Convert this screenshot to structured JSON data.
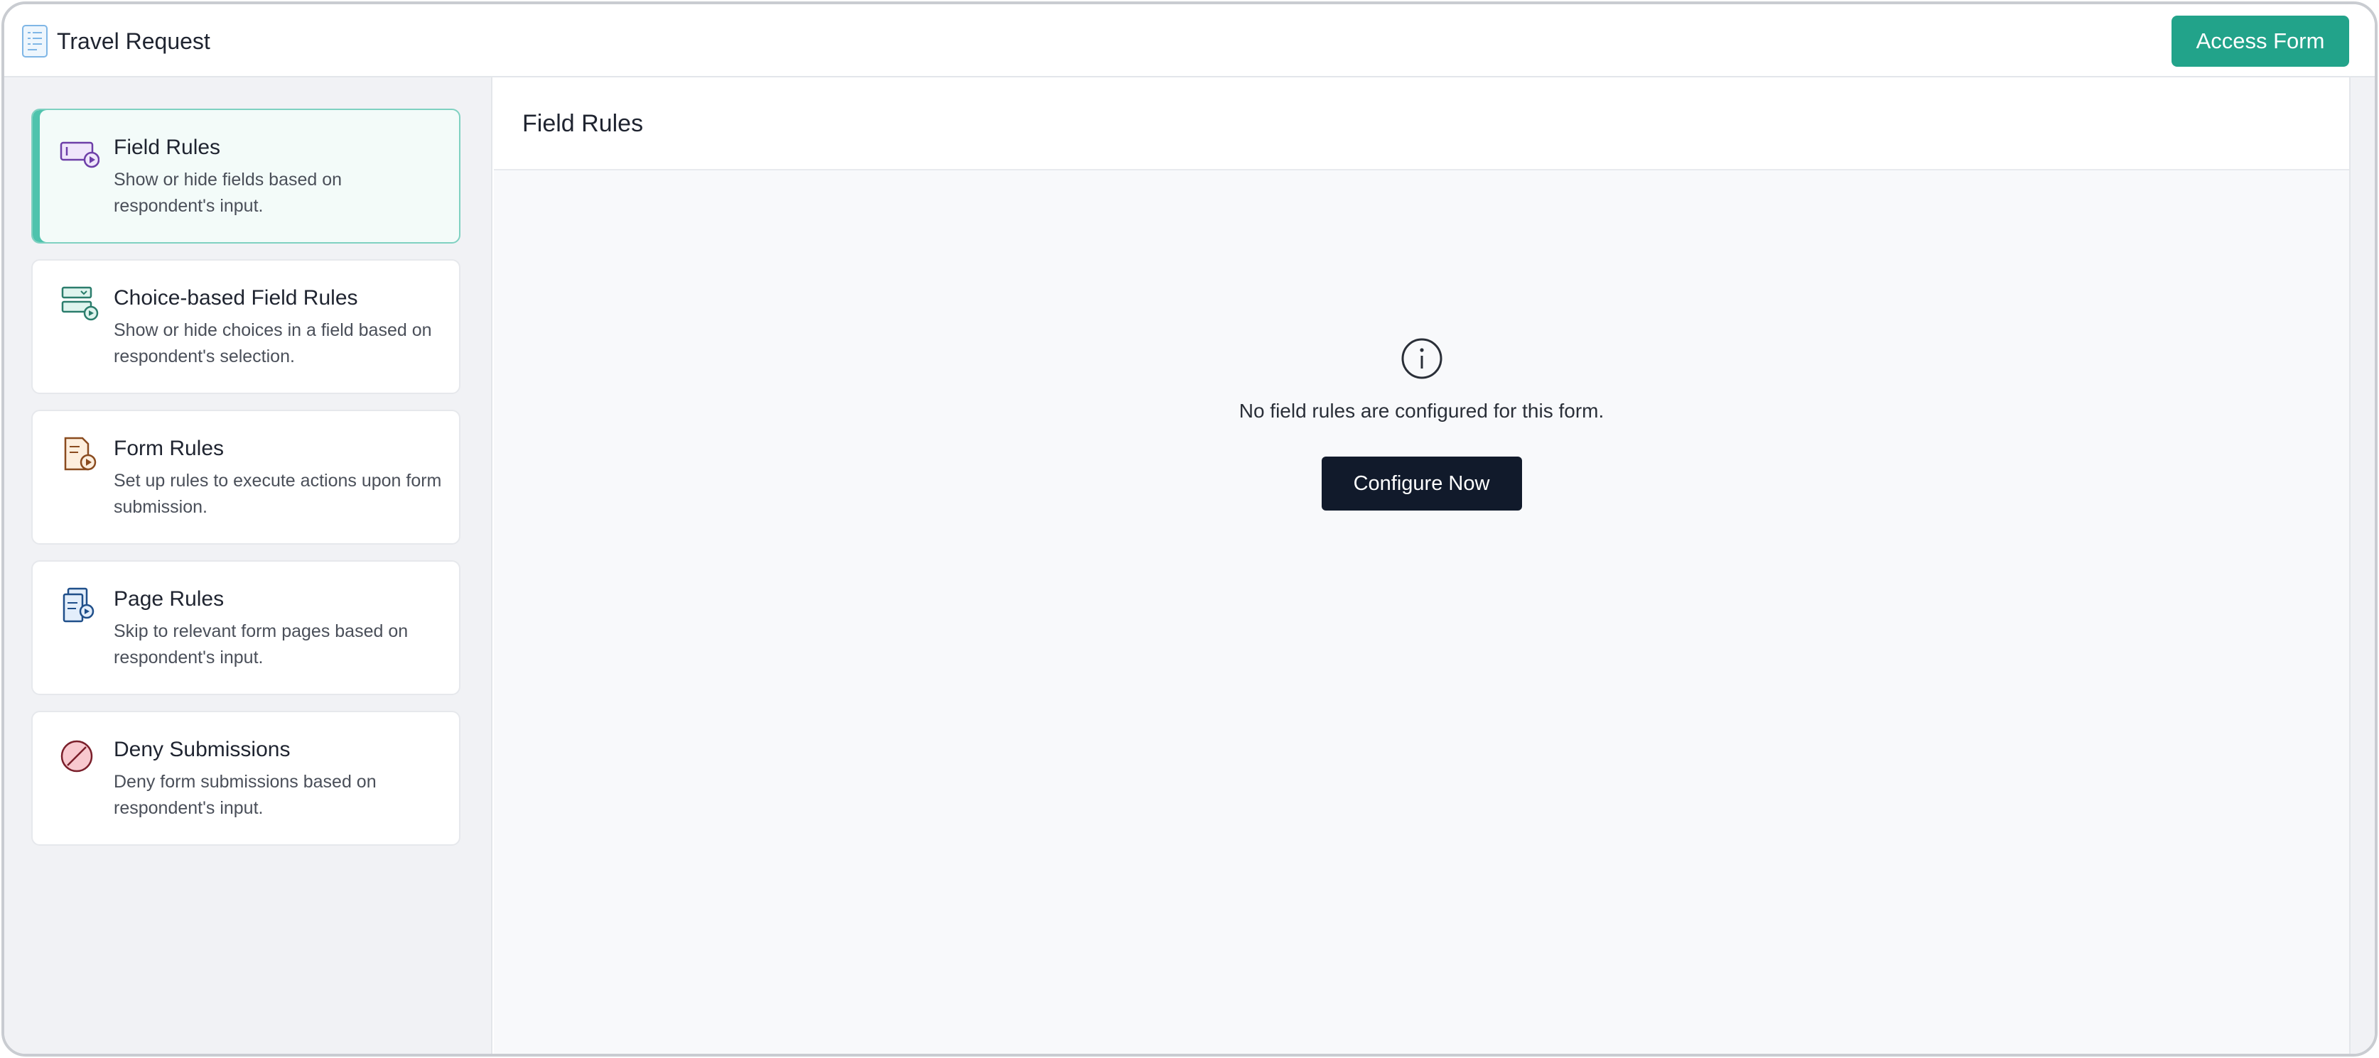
{
  "header": {
    "title": "Travel Request",
    "access_button": "Access Form"
  },
  "sidebar": {
    "items": [
      {
        "title": "Field Rules",
        "desc": "Show or hide fields based on respondent's input.",
        "icon": "field-rules-icon",
        "active": true
      },
      {
        "title": "Choice-based Field Rules",
        "desc": "Show or hide choices in a field based on respondent's selection.",
        "icon": "choice-rules-icon",
        "active": false
      },
      {
        "title": "Form Rules",
        "desc": "Set up rules to execute actions upon form submission.",
        "icon": "form-rules-icon",
        "active": false
      },
      {
        "title": "Page Rules",
        "desc": "Skip to relevant form pages based on respondent's input.",
        "icon": "page-rules-icon",
        "active": false
      },
      {
        "title": "Deny Submissions",
        "desc": "Deny form submissions based on respondent's input.",
        "icon": "deny-icon",
        "active": false
      }
    ]
  },
  "main": {
    "title": "Field Rules",
    "empty_message": "No field rules are configured for this form.",
    "configure_button": "Configure Now"
  },
  "colors": {
    "accent": "#22a38a",
    "active_card_border": "#7fd1c1",
    "dark_button": "#111a2b"
  }
}
